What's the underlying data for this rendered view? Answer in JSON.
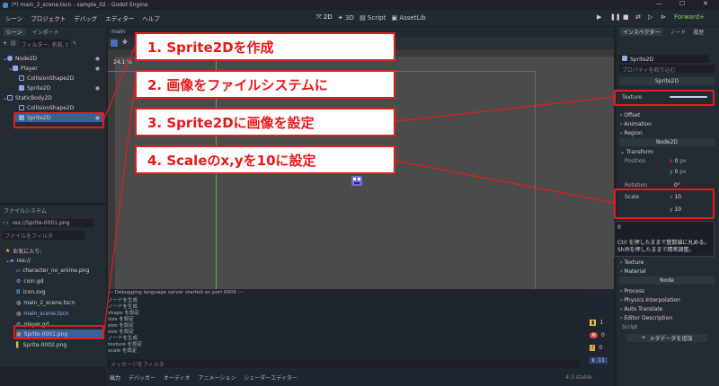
{
  "window": {
    "title": "(*) main_2_scene.tscn - sample_02 - Godot Engine"
  },
  "menu": {
    "items": [
      "シーン",
      "プロジェクト",
      "デバッグ",
      "エディター",
      "ヘルプ"
    ]
  },
  "workspaces": {
    "w2d": "2D",
    "w3d": "3D",
    "script": "Script",
    "assetlib": "AssetLib"
  },
  "renderer": "Forward+",
  "scene_dock": {
    "tab_scene": "シーン",
    "tab_import": "インポート",
    "filter_placeholder": "フィルター: 名前, t",
    "nodes": [
      "Node2D",
      "Player",
      "CollisionShape2D",
      "Sprite2D",
      "StaticBody2D",
      "CollisionShape2D",
      "Sprite2D"
    ]
  },
  "filesystem_dock": {
    "title": "ファイルシステム",
    "path": "res://Sprite-0001.png",
    "filter_placeholder": "ファイルをフィルタ",
    "favorites": "お気に入り:",
    "root": "res://",
    "files": [
      "character_no_anime.png",
      "coin.gd",
      "icon.svg",
      "main_2_scene.tscn",
      "main_scene.tscn",
      "player.gd",
      "Sprite-0001.png",
      "Sprite-0002.png"
    ]
  },
  "editor": {
    "tab": "main",
    "zoom": "24.1 %"
  },
  "output": {
    "lines": [
      "--- Debugging language server started on port 6005 ---",
      "ノードを生成",
      "ノードを生成",
      "shape を設定",
      "size を設定",
      "size を設定",
      "size を設定",
      "ノードを生成",
      "texture を設定",
      "scale を設定"
    ],
    "filter_placeholder": "メッセージをフィルタ",
    "counts": [
      "1",
      "0",
      "0",
      "11"
    ],
    "version": "4.3.stable"
  },
  "bottom_tabs": [
    "出力",
    "デバッガー",
    "オーディオ",
    "アニメーション",
    "シェーダーエディター"
  ],
  "inspector": {
    "tab_inspector": "インスペクター",
    "tab_node": "ノード",
    "tab_history": "履歴",
    "node_name": "Sprite2D",
    "filter_placeholder": "プロパティを絞り込む",
    "class_sprite": "Sprite2D",
    "texture_label": "Texture",
    "sections": [
      "Offset",
      "Animation",
      "Region"
    ],
    "class_node2d": "Node2D",
    "transform": "Transform",
    "position_label": "Position",
    "position_x": "0",
    "position_y": "0",
    "unit_px": "px",
    "rotation_label": "Rotation",
    "rotation_value": "0",
    "rotation_unit": "°",
    "scale_label": "Scale",
    "scale_x": "10",
    "scale_y": "10",
    "tooltip_value": "0",
    "tooltip_text": "Ctrl を押したままで整数値に丸める。Shiftを押したままで精密調整。",
    "lower_sections": [
      "Texture",
      "Material"
    ],
    "class_node": "Node",
    "node_sections": [
      "Process",
      "Physics Interpolation",
      "Auto Translate",
      "Editor Description"
    ],
    "script_label": "Script",
    "metadata_button": "メタデータを追加"
  },
  "callouts": [
    "1. Sprite2Dを作成",
    "2. 画像をファイルシステムに",
    "3. Sprite2Dに画像を設定",
    "4. Scaleのx,yを10に設定"
  ],
  "colors": {
    "accent_red": "#e41e1e",
    "node_icon_blue": "#8fa9f0",
    "selected_row": "#3a5f9b",
    "godot_bg": "#4b4b4b"
  }
}
